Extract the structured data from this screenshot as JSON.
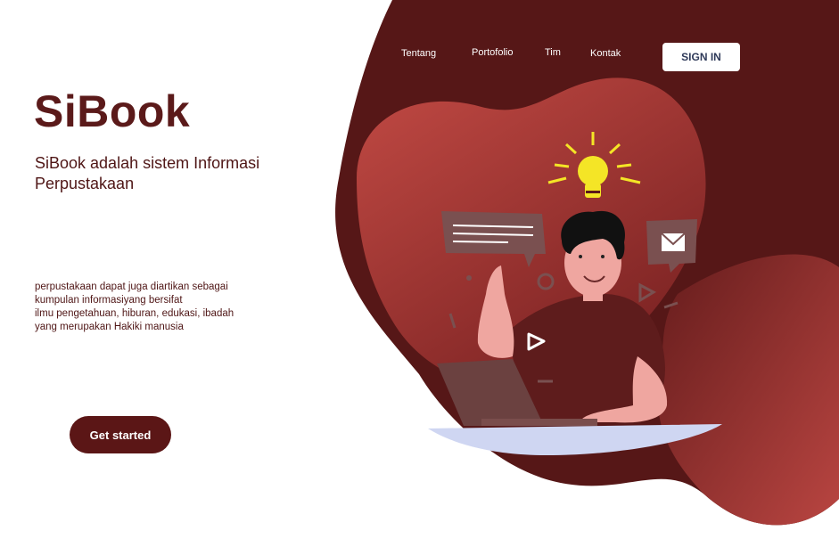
{
  "nav": {
    "links": [
      "Tentang",
      "Portofolio",
      "Tim",
      "Kontak"
    ],
    "signin_label": "SIGN IN"
  },
  "hero": {
    "brand": "SiBook",
    "tagline": "SiBook adalah sistem Informasi Perpustakaan",
    "description_lines": [
      "perpustakaan dapat juga diartikan sebagai",
      "kumpulan informasiyang bersifat",
      "ilmu pengetahuan, hiburan, edukasi, ibadah",
      "yang merupakan Hakiki manusia"
    ],
    "cta_label": "Get started"
  },
  "colors": {
    "brand_dark": "#5b1a1a",
    "blob_dark": "#561717",
    "blob_light": "#c24a44",
    "button_text": "#2f3a59"
  },
  "illustration": {
    "icons": [
      "lightbulb-icon",
      "chat-bubble-icon",
      "envelope-icon",
      "play-icon",
      "laptop-icon"
    ]
  }
}
